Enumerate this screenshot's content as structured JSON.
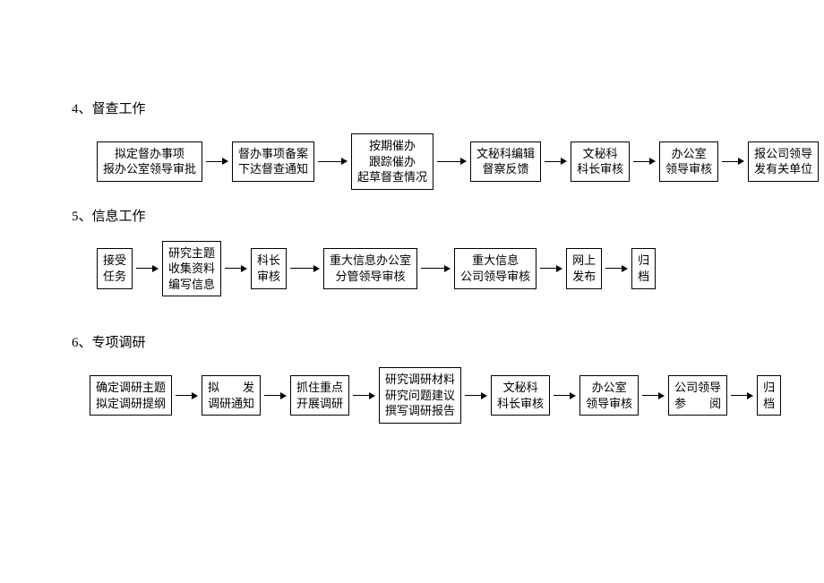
{
  "sections": [
    {
      "title": "4、督查工作",
      "boxes": [
        {
          "lines": [
            "拟定督办事项",
            "报办公室领导审批"
          ]
        },
        {
          "lines": [
            "督办事项备案",
            "下达督查通知"
          ]
        },
        {
          "lines": [
            "按期催办",
            "跟踪催办",
            "起草督查情况"
          ]
        },
        {
          "lines": [
            "文秘科编辑",
            "督察反馈"
          ]
        },
        {
          "lines": [
            "文秘科",
            "科长审核"
          ]
        },
        {
          "lines": [
            "办公室",
            "领导审核"
          ]
        },
        {
          "lines": [
            "报公司领导",
            "发有关单位"
          ]
        }
      ]
    },
    {
      "title": "5、信息工作",
      "boxes": [
        {
          "lines": [
            "接受",
            "任务"
          ]
        },
        {
          "lines": [
            "研究主题",
            "收集资料",
            "编写信息"
          ]
        },
        {
          "lines": [
            "科长",
            "审核"
          ]
        },
        {
          "lines": [
            "重大信息办公室",
            "分管领导审核"
          ]
        },
        {
          "lines": [
            "重大信息",
            "公司领导审核"
          ]
        },
        {
          "lines": [
            "网上",
            "发布"
          ]
        },
        {
          "lines": [
            "归",
            "档"
          ]
        }
      ]
    },
    {
      "title": "6、专项调研",
      "boxes": [
        {
          "lines": [
            "确定调研主题",
            "拟定调研提纲"
          ]
        },
        {
          "lines": [
            "拟　　发",
            "调研通知"
          ]
        },
        {
          "lines": [
            "抓住重点",
            "开展调研"
          ]
        },
        {
          "lines": [
            "研究调研材料",
            "研究问题建议",
            "撰写调研报告"
          ]
        },
        {
          "lines": [
            "文秘科",
            "科长审核"
          ]
        },
        {
          "lines": [
            "办公室",
            "领导审核"
          ]
        },
        {
          "lines": [
            "公司领导",
            "参　　阅"
          ]
        },
        {
          "lines": [
            "归",
            "档"
          ]
        }
      ]
    }
  ]
}
